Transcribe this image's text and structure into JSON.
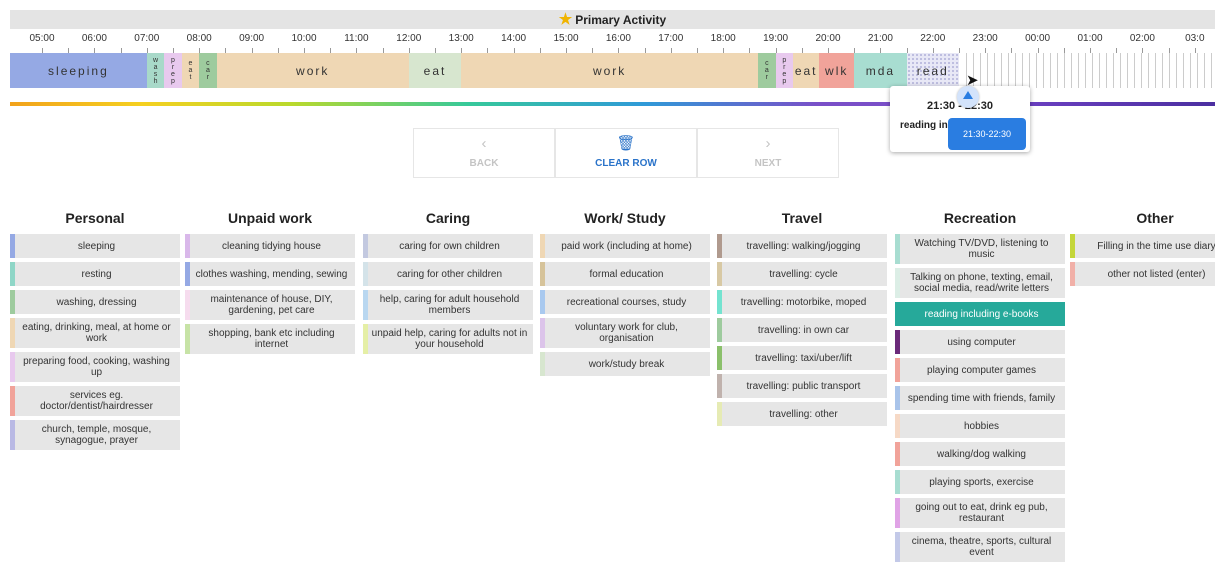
{
  "header": {
    "title": "Primary Activity",
    "star_icon": "star-icon"
  },
  "hours": [
    "05:00",
    "06:00",
    "07:00",
    "08:00",
    "09:00",
    "10:00",
    "11:00",
    "12:00",
    "13:00",
    "14:00",
    "15:00",
    "16:00",
    "17:00",
    "18:00",
    "19:00",
    "20:00",
    "21:00",
    "22:00",
    "23:00",
    "00:00",
    "01:00",
    "02:00",
    "03:0"
  ],
  "timeline": [
    {
      "label": "sleeping",
      "start": "05:00",
      "end": "07:00",
      "color": "#95a9e4"
    },
    {
      "label": "wash",
      "start": "07:00",
      "end": "07:20",
      "color": "#a8d9c9"
    },
    {
      "label": "prep",
      "start": "07:20",
      "end": "07:40",
      "color": "#e8c9ee"
    },
    {
      "label": "eat",
      "start": "07:40",
      "end": "08:00",
      "color": "#efd7b4"
    },
    {
      "label": "car",
      "start": "08:00",
      "end": "08:20",
      "color": "#9ecb9e"
    },
    {
      "label": "work",
      "start": "08:20",
      "end": "12:00",
      "color": "#efd7b4"
    },
    {
      "label": "eat",
      "start": "12:00",
      "end": "13:00",
      "color": "#d7e6cf"
    },
    {
      "label": "work",
      "start": "13:00",
      "end": "18:40",
      "color": "#efd7b4"
    },
    {
      "label": "car",
      "start": "18:40",
      "end": "19:00",
      "color": "#9ecb9e"
    },
    {
      "label": "prep",
      "start": "19:00",
      "end": "19:20",
      "color": "#e8c9ee"
    },
    {
      "label": "eat",
      "start": "19:20",
      "end": "19:50",
      "color": "#efd7b4"
    },
    {
      "label": "wlk",
      "start": "19:50",
      "end": "20:30",
      "color": "#f1a39a"
    },
    {
      "label": "mda",
      "start": "20:30",
      "end": "21:30",
      "color": "#a8ddd1"
    },
    {
      "label": "read",
      "start": "21:30",
      "end": "22:30",
      "color": "#e8e8f6"
    }
  ],
  "popup": {
    "time": "21:30 - 22:30",
    "activity": "reading including e-books",
    "tooltip": "21:30-22:30"
  },
  "nav": {
    "back": {
      "label": "BACK",
      "icon": "chevron-left-icon"
    },
    "clear": {
      "label": "CLEAR ROW",
      "icon": "trash-icon"
    },
    "next": {
      "label": "NEXT",
      "icon": "chevron-right-icon"
    }
  },
  "categories": [
    {
      "title": "Personal",
      "items": [
        {
          "label": "sleeping",
          "color": "#95a9e4"
        },
        {
          "label": "resting",
          "color": "#8fd6c7"
        },
        {
          "label": "washing, dressing",
          "color": "#9ecb9e"
        },
        {
          "label": "eating, drinking, meal, at home or work",
          "color": "#efd7b4"
        },
        {
          "label": "preparing food, cooking, washing up",
          "color": "#e8c9ee"
        },
        {
          "label": "services eg. doctor/dentist/hairdresser",
          "color": "#f1a39a"
        },
        {
          "label": "church, temple, mosque, synagogue, prayer",
          "color": "#b9b9e4"
        }
      ]
    },
    {
      "title": "Unpaid work",
      "items": [
        {
          "label": "cleaning tidying house",
          "color": "#d9b8ea"
        },
        {
          "label": "clothes washing, mending, sewing",
          "color": "#95a9e4"
        },
        {
          "label": "maintenance of house, DIY, gardening, pet care",
          "color": "#f6dcee"
        },
        {
          "label": "shopping, bank etc including internet",
          "color": "#c7e3a6"
        }
      ]
    },
    {
      "title": "Caring",
      "items": [
        {
          "label": "caring for own children",
          "color": "#c3c9e0"
        },
        {
          "label": "caring for other children",
          "color": "#d4e3e9"
        },
        {
          "label": "help, caring for adult household members",
          "color": "#b9d7f0"
        },
        {
          "label": "unpaid help, caring for adults not in your household",
          "color": "#e5efa6"
        }
      ]
    },
    {
      "title": "Work/ Study",
      "items": [
        {
          "label": "paid work (including at home)",
          "color": "#efd7b4"
        },
        {
          "label": "formal education",
          "color": "#d6c39a"
        },
        {
          "label": "recreational courses, study",
          "color": "#a9c9ef"
        },
        {
          "label": "voluntary work for club, organisation",
          "color": "#dcc4ea"
        },
        {
          "label": "work/study break",
          "color": "#d7e6cf"
        }
      ]
    },
    {
      "title": "Travel",
      "items": [
        {
          "label": "travelling: walking/jogging",
          "color": "#b09a8e"
        },
        {
          "label": "travelling: cycle",
          "color": "#d8c9a4"
        },
        {
          "label": "travelling: motorbike, moped",
          "color": "#74e3d0"
        },
        {
          "label": "travelling: in own car",
          "color": "#9ecb9e"
        },
        {
          "label": "travelling: taxi/uber/lift",
          "color": "#8bc06b"
        },
        {
          "label": "travelling: public transport",
          "color": "#c0b2ad"
        },
        {
          "label": "travelling: other",
          "color": "#e6ebb4"
        }
      ]
    },
    {
      "title": "Recreation",
      "items": [
        {
          "label": "Watching TV/DVD, listening to music",
          "color": "#a8ddd1"
        },
        {
          "label": "Talking on phone, texting, email, social media, read/write letters",
          "color": "#dceee6"
        },
        {
          "label": "reading including e-books",
          "color": "#26a99a",
          "selected": true
        },
        {
          "label": "using computer",
          "color": "#6b2a7a"
        },
        {
          "label": "playing computer games",
          "color": "#f1a39a"
        },
        {
          "label": "spending time with friends, family",
          "color": "#a9c4ea"
        },
        {
          "label": "hobbies",
          "color": "#f6d9c6"
        },
        {
          "label": "walking/dog walking",
          "color": "#f1a39a"
        },
        {
          "label": "playing sports, exercise",
          "color": "#a8ddd1"
        },
        {
          "label": "going out to eat, drink eg pub, restaurant",
          "color": "#e0a3e6"
        },
        {
          "label": "cinema, theatre, sports, cultural event",
          "color": "#c3c9e8"
        }
      ]
    },
    {
      "title": "Other",
      "items": [
        {
          "label": "Filling in the time use diary",
          "color": "#c4d63a"
        },
        {
          "label": "other not listed (enter)",
          "color": "#f1b0a8"
        }
      ]
    }
  ]
}
